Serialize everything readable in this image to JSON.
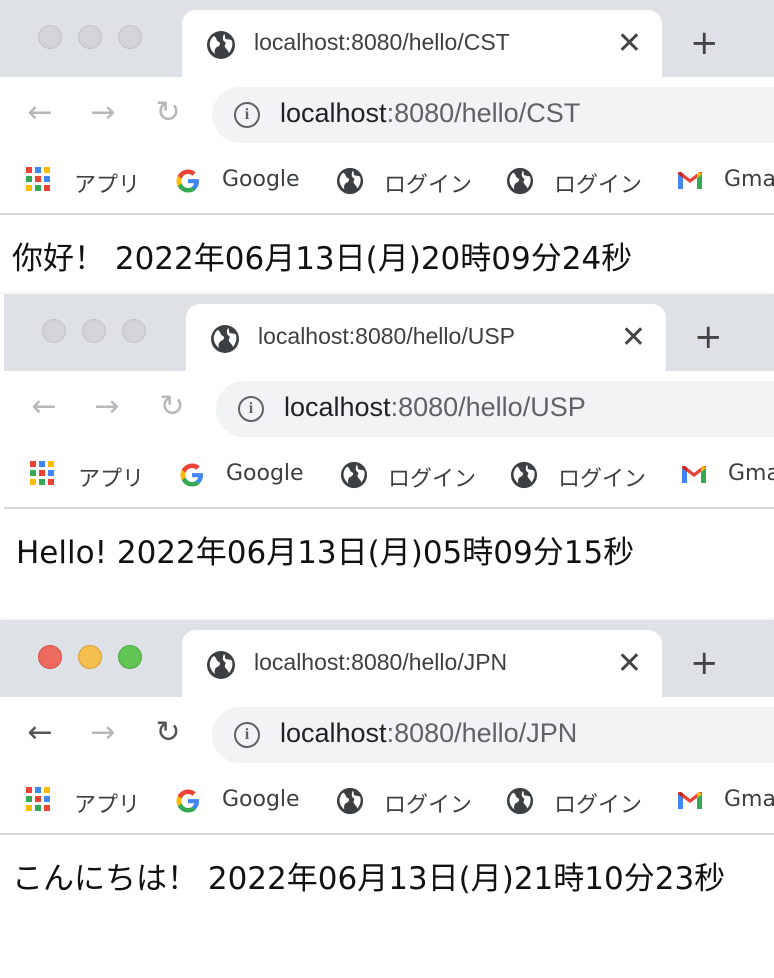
{
  "windows": [
    {
      "tab_title": "localhost:8080/hello/CST",
      "url_host": "localhost",
      "url_rest": ":8080/hello/CST",
      "active": false,
      "greeting": "你好！ 2022年06月13日(月)20時09分24秒"
    },
    {
      "tab_title": "localhost:8080/hello/USP",
      "url_host": "localhost",
      "url_rest": ":8080/hello/USP",
      "active": false,
      "greeting": "Hello! 2022年06月13日(月)05時09分15秒"
    },
    {
      "tab_title": "localhost:8080/hello/JPN",
      "url_host": "localhost",
      "url_rest": ":8080/hello/JPN",
      "active": true,
      "greeting": "こんにちは！ 2022年06月13日(月)21時10分23秒"
    }
  ],
  "chrome": {
    "close_glyph": "✕",
    "newtab_glyph": "+",
    "back_glyph": "←",
    "forward_glyph": "→",
    "reload_glyph": "↻",
    "info_glyph": "i"
  },
  "bookmarks": {
    "apps": "アプリ",
    "google": "Google",
    "login1": "ログイン",
    "login2": "ログイン",
    "gmail": "Gmail"
  },
  "colors": {
    "tabstrip_bg": "#dee1e6",
    "omnibox_bg": "#f1f3f4",
    "traffic_red": "#ed6a5e",
    "traffic_yellow": "#f5bf4f",
    "traffic_green": "#61c454"
  }
}
